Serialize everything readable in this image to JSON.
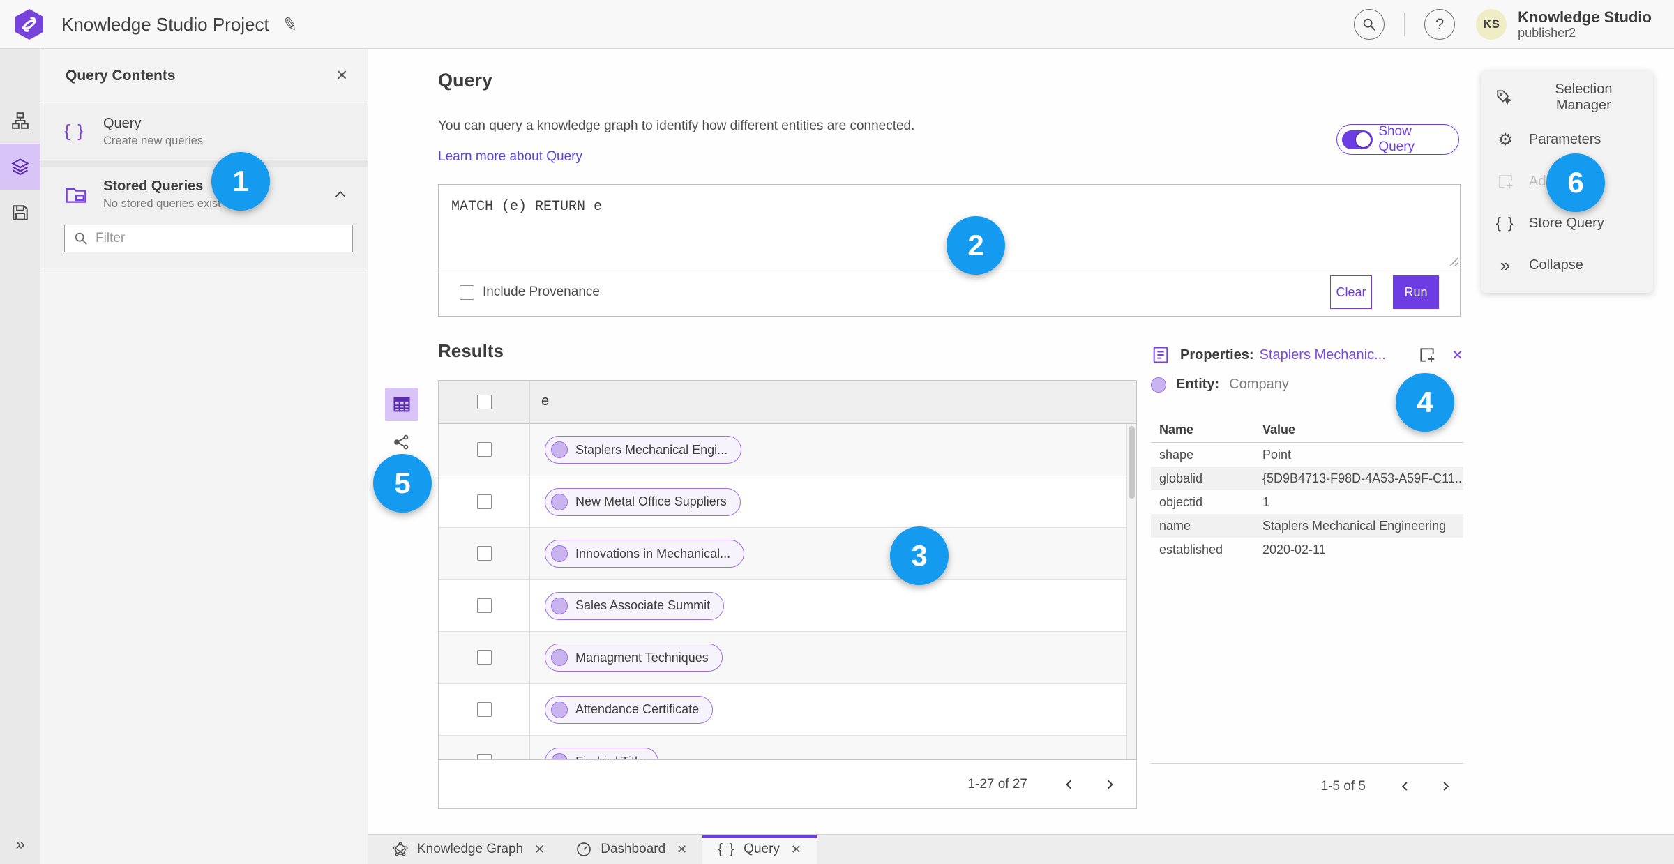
{
  "app": {
    "title": "Knowledge Studio Project",
    "user_initials": "KS",
    "user_name": "Knowledge Studio",
    "user_role": "publisher2"
  },
  "icons": {
    "close": "✕",
    "help": "?",
    "pencil": "✎",
    "braces": "{ }",
    "gear": "⚙",
    "collapse": "»",
    "expand": "»"
  },
  "contents_panel": {
    "title": "Query Contents",
    "query_item": {
      "title": "Query",
      "subtitle": "Create new queries"
    },
    "stored_item": {
      "title": "Stored Queries",
      "subtitle": "No stored queries exist"
    },
    "filter_placeholder": "Filter"
  },
  "query": {
    "title": "Query",
    "description": "You can query a knowledge graph to identify how different entities are connected.",
    "learn_more": "Learn more about Query",
    "show_query_label": "Show Query",
    "query_text": "MATCH (e) RETURN e",
    "include_provenance_label": "Include Provenance",
    "clear_label": "Clear",
    "run_label": "Run"
  },
  "results": {
    "title": "Results",
    "column_header": "e",
    "rows": [
      {
        "label": "Staplers Mechanical Engi..."
      },
      {
        "label": "New Metal Office Suppliers"
      },
      {
        "label": "Innovations in Mechanical..."
      },
      {
        "label": "Sales Associate Summit"
      },
      {
        "label": "Managment Techniques"
      },
      {
        "label": "Attendance Certificate"
      },
      {
        "label": "Firebird Title"
      }
    ],
    "pagination": "1-27 of 27"
  },
  "properties": {
    "label": "Properties:",
    "entity_name": "Staplers Mechanic...",
    "entity_label": "Entity:",
    "entity_type": "Company",
    "columns": {
      "name": "Name",
      "value": "Value"
    },
    "rows": [
      {
        "name": "shape",
        "value": "Point"
      },
      {
        "name": "globalid",
        "value": "{5D9B4713-F98D-4A53-A59F-C11..."
      },
      {
        "name": "objectid",
        "value": "1"
      },
      {
        "name": "name",
        "value": "Staplers Mechanical Engineering"
      },
      {
        "name": "established",
        "value": "2020-02-11"
      }
    ],
    "pagination": "1-5 of 5"
  },
  "tools": {
    "items": [
      {
        "label": "Selection Manager"
      },
      {
        "label": "Parameters"
      },
      {
        "label": "Ad",
        "disabled": true
      },
      {
        "label": "Store Query"
      },
      {
        "label": "Collapse"
      }
    ]
  },
  "tabs": [
    {
      "label": "Knowledge Graph"
    },
    {
      "label": "Dashboard"
    },
    {
      "label": "Query",
      "active": true
    }
  ],
  "annotations": [
    "1",
    "2",
    "3",
    "4",
    "5",
    "6"
  ],
  "colors": {
    "accent_purple": "#6D3CE3",
    "icon_purple": "#7A3FE0",
    "entity_fill": "#C9B4EF",
    "entity_border": "#9A6EE8",
    "annotation_blue": "#149BEF",
    "link": "#5B43D8"
  }
}
